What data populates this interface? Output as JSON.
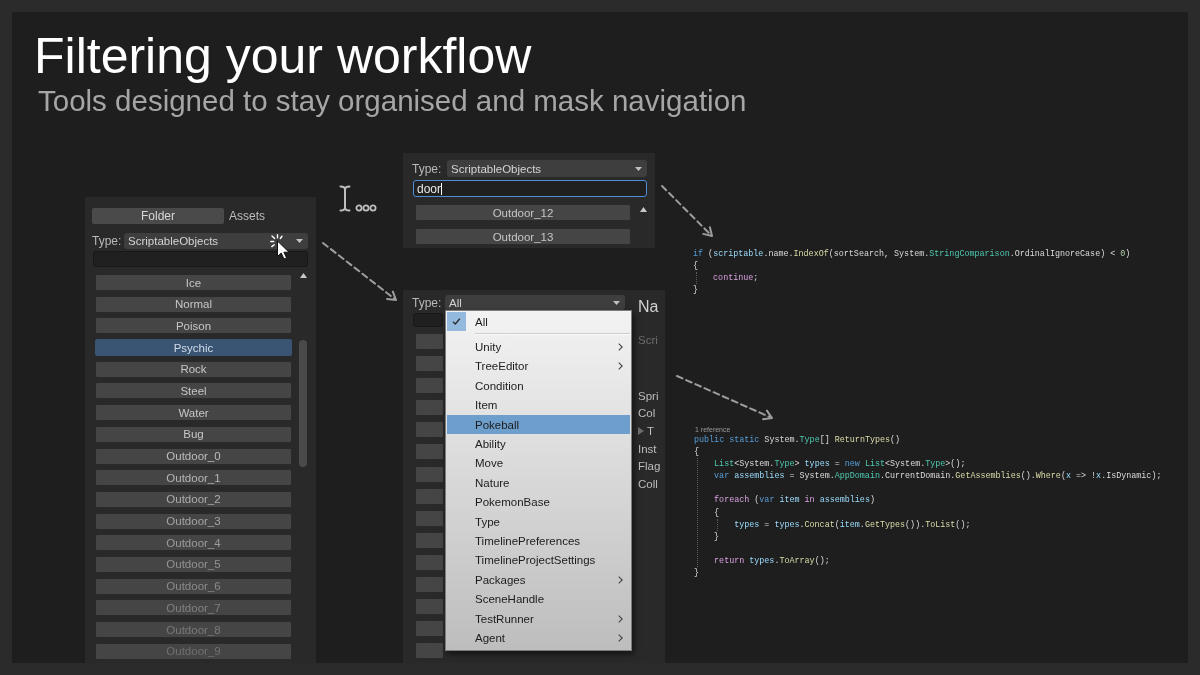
{
  "slide": {
    "title": "Filtering your workflow",
    "subtitle": "Tools designed to stay organised and mask navigation"
  },
  "asset_panel": {
    "tabs": [
      {
        "label": "Folder",
        "selected": true
      },
      {
        "label": "Assets",
        "selected": false
      }
    ],
    "type_label": "Type:",
    "type_value": "ScriptableObjects",
    "items": [
      {
        "label": "Ice",
        "selected": false
      },
      {
        "label": "Normal",
        "selected": false
      },
      {
        "label": "Poison",
        "selected": false
      },
      {
        "label": "Psychic",
        "selected": true
      },
      {
        "label": "Rock",
        "selected": false
      },
      {
        "label": "Steel",
        "selected": false
      },
      {
        "label": "Water",
        "selected": false
      },
      {
        "label": "Bug",
        "selected": false
      },
      {
        "label": "Outdoor_0",
        "selected": false
      },
      {
        "label": "Outdoor_1",
        "selected": false
      },
      {
        "label": "Outdoor_2",
        "selected": false
      },
      {
        "label": "Outdoor_3",
        "selected": false
      },
      {
        "label": "Outdoor_4",
        "selected": false
      },
      {
        "label": "Outdoor_5",
        "selected": false
      },
      {
        "label": "Outdoor_6",
        "selected": false
      },
      {
        "label": "Outdoor_7",
        "selected": false
      },
      {
        "label": "Outdoor_8",
        "selected": false
      },
      {
        "label": "Outdoor_9",
        "selected": false
      }
    ]
  },
  "search_panel": {
    "type_label": "Type:",
    "type_value": "ScriptableObjects",
    "search": {
      "value": "door",
      "focused": true
    },
    "items": [
      {
        "label": "Outdoor_12",
        "selected": false
      },
      {
        "label": "Outdoor_13",
        "selected": false
      }
    ]
  },
  "type_menu_panel": {
    "type_label": "Type:",
    "type_value": "All",
    "inspector_heading": "Na",
    "inspector_groups": [
      {
        "labels": [
          {
            "text": "Scri",
            "kind": "muted"
          }
        ]
      },
      {
        "labels": [
          {
            "text": "Spri",
            "kind": "field"
          },
          {
            "text": "Col",
            "kind": "field"
          },
          {
            "text": "T",
            "kind": "foldout"
          },
          {
            "text": "Inst",
            "kind": "field"
          },
          {
            "text": "Flag",
            "kind": "field"
          },
          {
            "text": "Coll",
            "kind": "field"
          }
        ]
      }
    ],
    "menu": {
      "groups": [
        {
          "items": [
            {
              "label": "All",
              "selected": true,
              "highlighted": false,
              "submenu": false
            }
          ]
        },
        {
          "items": [
            {
              "label": "Unity",
              "selected": false,
              "highlighted": false,
              "submenu": true
            },
            {
              "label": "TreeEditor",
              "selected": false,
              "highlighted": false,
              "submenu": true
            },
            {
              "label": "Condition",
              "selected": false,
              "highlighted": false,
              "submenu": false
            },
            {
              "label": "Item",
              "selected": false,
              "highlighted": false,
              "submenu": false
            },
            {
              "label": "Pokeball",
              "selected": false,
              "highlighted": true,
              "submenu": false
            },
            {
              "label": "Ability",
              "selected": false,
              "highlighted": false,
              "submenu": false
            },
            {
              "label": "Move",
              "selected": false,
              "highlighted": false,
              "submenu": false
            },
            {
              "label": "Nature",
              "selected": false,
              "highlighted": false,
              "submenu": false
            },
            {
              "label": "PokemonBase",
              "selected": false,
              "highlighted": false,
              "submenu": false
            },
            {
              "label": "Type",
              "selected": false,
              "highlighted": false,
              "submenu": false
            },
            {
              "label": "TimelinePreferences",
              "selected": false,
              "highlighted": false,
              "submenu": false
            },
            {
              "label": "TimelineProjectSettings",
              "selected": false,
              "highlighted": false,
              "submenu": false
            },
            {
              "label": "Packages",
              "selected": false,
              "highlighted": false,
              "submenu": true
            },
            {
              "label": "SceneHandle",
              "selected": false,
              "highlighted": false,
              "submenu": false
            },
            {
              "label": "TestRunner",
              "selected": false,
              "highlighted": false,
              "submenu": true
            },
            {
              "label": "Agent",
              "selected": false,
              "highlighted": false,
              "submenu": true
            }
          ]
        }
      ]
    }
  },
  "code_snippets": [
    {
      "lines": [
        {
          "kind": "code",
          "tokens": [
            {
              "text": "if",
              "kind": "keyword"
            },
            {
              "text": " (",
              "kind": "plain"
            },
            {
              "text": "scriptable",
              "kind": "variable"
            },
            {
              "text": ".name.",
              "kind": "plain"
            },
            {
              "text": "IndexOf",
              "kind": "method"
            },
            {
              "text": "(sortSearch, System.",
              "kind": "plain"
            },
            {
              "text": "StringComparison",
              "kind": "type"
            },
            {
              "text": ".OrdinalIgnoreCase) < ",
              "kind": "plain"
            },
            {
              "text": "0",
              "kind": "number"
            },
            {
              "text": ")",
              "kind": "plain"
            }
          ]
        },
        {
          "kind": "code",
          "tokens": [
            {
              "text": "{",
              "kind": "plain"
            }
          ],
          "children": [
            {
              "kind": "code",
              "tokens": [
                {
                  "text": "continue",
                  "kind": "control"
                },
                {
                  "text": ";",
                  "kind": "plain"
                }
              ]
            }
          ]
        },
        {
          "kind": "code",
          "tokens": [
            {
              "text": "}",
              "kind": "plain"
            }
          ]
        }
      ]
    },
    {
      "caption": "1 reference",
      "lines": [
        {
          "kind": "code",
          "tokens": [
            {
              "text": "public static",
              "kind": "keyword"
            },
            {
              "text": " System.",
              "kind": "plain"
            },
            {
              "text": "Type",
              "kind": "type"
            },
            {
              "text": "[] ",
              "kind": "plain"
            },
            {
              "text": "ReturnTypes",
              "kind": "method"
            },
            {
              "text": "()",
              "kind": "plain"
            }
          ]
        },
        {
          "kind": "code",
          "tokens": [
            {
              "text": "{",
              "kind": "plain"
            }
          ],
          "children": [
            {
              "kind": "code",
              "tokens": [
                {
                  "text": "List",
                  "kind": "type"
                },
                {
                  "text": "<System.",
                  "kind": "plain"
                },
                {
                  "text": "Type",
                  "kind": "type"
                },
                {
                  "text": "> ",
                  "kind": "plain"
                },
                {
                  "text": "types",
                  "kind": "variable"
                },
                {
                  "text": " = ",
                  "kind": "plain"
                },
                {
                  "text": "new ",
                  "kind": "keyword"
                },
                {
                  "text": "List",
                  "kind": "type"
                },
                {
                  "text": "<System.",
                  "kind": "plain"
                },
                {
                  "text": "Type",
                  "kind": "type"
                },
                {
                  "text": ">();",
                  "kind": "plain"
                }
              ]
            },
            {
              "kind": "code",
              "tokens": [
                {
                  "text": "var ",
                  "kind": "keyword"
                },
                {
                  "text": "assemblies",
                  "kind": "variable"
                },
                {
                  "text": " = System.",
                  "kind": "plain"
                },
                {
                  "text": "AppDomain",
                  "kind": "type"
                },
                {
                  "text": ".CurrentDomain.",
                  "kind": "plain"
                },
                {
                  "text": "GetAssemblies",
                  "kind": "method"
                },
                {
                  "text": "().",
                  "kind": "plain"
                },
                {
                  "text": "Where",
                  "kind": "method"
                },
                {
                  "text": "(",
                  "kind": "plain"
                },
                {
                  "text": "x",
                  "kind": "variable"
                },
                {
                  "text": " => !",
                  "kind": "plain"
                },
                {
                  "text": "x",
                  "kind": "variable"
                },
                {
                  "text": ".IsDynamic);",
                  "kind": "plain"
                }
              ]
            },
            {
              "kind": "blank"
            },
            {
              "kind": "code",
              "tokens": [
                {
                  "text": "foreach",
                  "kind": "control"
                },
                {
                  "text": " (",
                  "kind": "plain"
                },
                {
                  "text": "var ",
                  "kind": "keyword"
                },
                {
                  "text": "item ",
                  "kind": "variable"
                },
                {
                  "text": "in ",
                  "kind": "control"
                },
                {
                  "text": "assemblies",
                  "kind": "variable"
                },
                {
                  "text": ")",
                  "kind": "plain"
                }
              ]
            },
            {
              "kind": "code",
              "tokens": [
                {
                  "text": "{",
                  "kind": "plain"
                }
              ],
              "children": [
                {
                  "kind": "code",
                  "tokens": [
                    {
                      "text": "types",
                      "kind": "variable"
                    },
                    {
                      "text": " = ",
                      "kind": "plain"
                    },
                    {
                      "text": "types",
                      "kind": "variable"
                    },
                    {
                      "text": ".",
                      "kind": "plain"
                    },
                    {
                      "text": "Concat",
                      "kind": "method"
                    },
                    {
                      "text": "(",
                      "kind": "plain"
                    },
                    {
                      "text": "item",
                      "kind": "variable"
                    },
                    {
                      "text": ".",
                      "kind": "plain"
                    },
                    {
                      "text": "GetTypes",
                      "kind": "method"
                    },
                    {
                      "text": "()).",
                      "kind": "plain"
                    },
                    {
                      "text": "ToList",
                      "kind": "method"
                    },
                    {
                      "text": "();",
                      "kind": "plain"
                    }
                  ]
                }
              ]
            },
            {
              "kind": "code",
              "tokens": [
                {
                  "text": "}",
                  "kind": "plain"
                }
              ]
            },
            {
              "kind": "blank"
            },
            {
              "kind": "code",
              "tokens": [
                {
                  "text": "return ",
                  "kind": "control"
                },
                {
                  "text": "types",
                  "kind": "variable"
                },
                {
                  "text": ".",
                  "kind": "plain"
                },
                {
                  "text": "ToArray",
                  "kind": "method"
                },
                {
                  "text": "();",
                  "kind": "plain"
                }
              ]
            }
          ]
        },
        {
          "kind": "code",
          "tokens": [
            {
              "text": "}",
              "kind": "plain"
            }
          ]
        }
      ]
    }
  ]
}
